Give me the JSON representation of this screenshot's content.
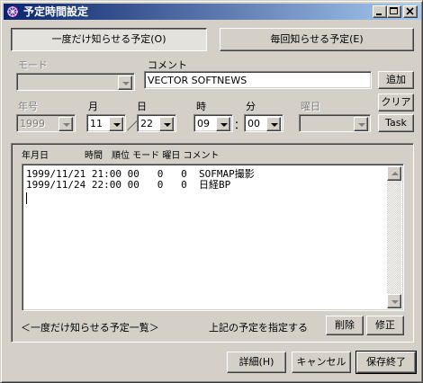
{
  "window": {
    "title": "予定時間設定",
    "controls": {
      "minimize": "_",
      "maximize": "□",
      "close": "×"
    }
  },
  "mode_buttons": {
    "once": "一度だけ知らせる予定(O)",
    "every": "毎回知らせる予定(E)"
  },
  "fields": {
    "mode_label": "モード",
    "mode_value": "",
    "comment_label": "コメント",
    "comment_value": "VECTOR SOFTNEWS",
    "year_label": "年号",
    "year_value": "1999",
    "month_label": "月",
    "month_value": "11",
    "day_label": "日",
    "day_value": "22",
    "slash": "／",
    "hour_label": "時",
    "hour_value": "09",
    "colon": "：",
    "minute_label": "分",
    "minute_value": "00",
    "weekday_label": "曜日",
    "weekday_value": ""
  },
  "side_buttons": {
    "add": "追加",
    "clear": "クリア",
    "task": "Task"
  },
  "schedule_list": {
    "header": "年月日　　　　時間　順位 モード 曜日 コメント",
    "rows": [
      "1999/11/21 21:00 00   0   0  SOFMAP撮影",
      "1999/11/24 22:00 00   0   0  日経BP"
    ],
    "caption": "＜一度だけ知らせる予定一覧＞",
    "apply_text": "上記の予定を指定する"
  },
  "list_buttons": {
    "delete": "削除",
    "edit": "修正"
  },
  "bottom_buttons": {
    "details": "詳細(H)",
    "cancel": "キャンセル",
    "save_exit": "保存終了"
  }
}
